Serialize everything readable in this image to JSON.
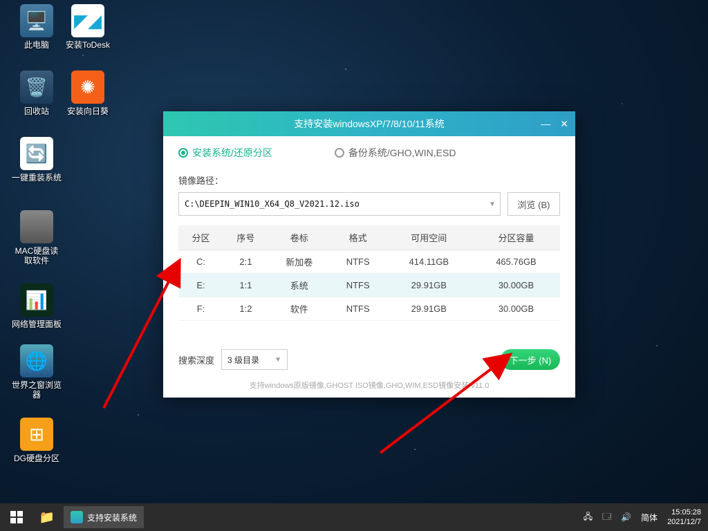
{
  "desktop_icons": {
    "this_pc": "此电脑",
    "recycle_bin": "回收站",
    "reinstall": "一键重装系统",
    "mac_reader": "MAC硬盘读取软件",
    "net_panel": "网络管理面板",
    "world_browser": "世界之窗浏览器",
    "dg_part": "DG硬盘分区",
    "todesk": "安装ToDesk",
    "sunflower": "安装向日葵"
  },
  "dialog": {
    "title": "支持安装windowsXP/7/8/10/11系统",
    "radio_install": "安装系统/还原分区",
    "radio_backup": "备份系统/GHO,WIN,ESD",
    "path_label": "镜像路径：",
    "path_value": "C:\\DEEPIN_WIN10_X64_Q8_V2021.12.iso",
    "browse_label": "浏览 (B)",
    "table": {
      "headers": {
        "part": "分区",
        "seq": "序号",
        "vol": "卷标",
        "fmt": "格式",
        "free": "可用空间",
        "cap": "分区容量"
      },
      "rows": [
        {
          "part": "C:",
          "seq": "2:1",
          "vol": "新加卷",
          "fmt": "NTFS",
          "free": "414.11GB",
          "cap": "465.76GB",
          "selected": false
        },
        {
          "part": "E:",
          "seq": "1:1",
          "vol": "系统",
          "fmt": "NTFS",
          "free": "29.91GB",
          "cap": "30.00GB",
          "selected": true
        },
        {
          "part": "F:",
          "seq": "1:2",
          "vol": "软件",
          "fmt": "NTFS",
          "free": "29.91GB",
          "cap": "30.00GB",
          "selected": false
        }
      ]
    },
    "depth_label": "搜索深度",
    "depth_value": "3 级目录",
    "next_label": "下一步 (N)",
    "footer": "支持windows原版镜像,GHOST ISO镜像,GHO,WIM,ESD镜像安装 v11.0"
  },
  "taskbar": {
    "active_app": "支持安装系统",
    "ime": "简体",
    "time": "15:05:28",
    "date": "2021/12/7"
  }
}
